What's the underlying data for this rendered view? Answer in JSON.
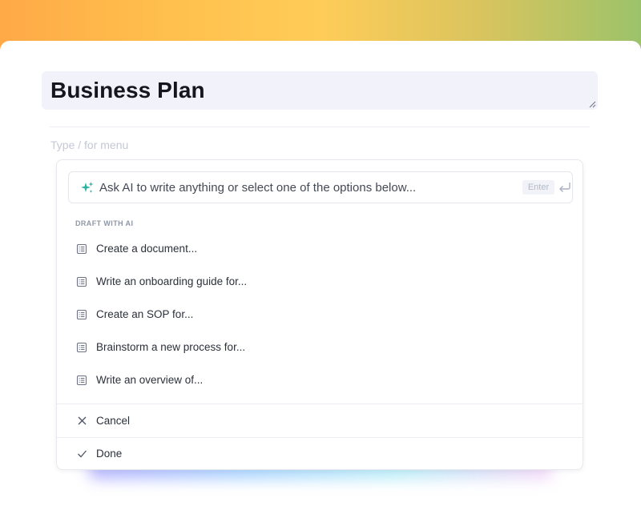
{
  "document": {
    "title": "Business Plan",
    "block_placeholder": "Type / for menu"
  },
  "ai_menu": {
    "prompt_placeholder": "Ask AI to write anything or select one of the options below...",
    "enter_label": "Enter",
    "section_label": "DRAFT WITH AI",
    "items": [
      {
        "label": "Create a document...",
        "icon": "list-icon"
      },
      {
        "label": "Write an onboarding guide for...",
        "icon": "list-icon"
      },
      {
        "label": "Create an SOP for...",
        "icon": "list-icon"
      },
      {
        "label": "Brainstorm a new process for...",
        "icon": "list-icon"
      },
      {
        "label": "Write an overview of...",
        "icon": "list-icon"
      }
    ],
    "cancel_label": "Cancel",
    "done_label": "Done"
  },
  "colors": {
    "accent_sparkle": "#2bb3a3",
    "title_bg": "#f1f2fa",
    "text_primary": "#2b303a"
  }
}
